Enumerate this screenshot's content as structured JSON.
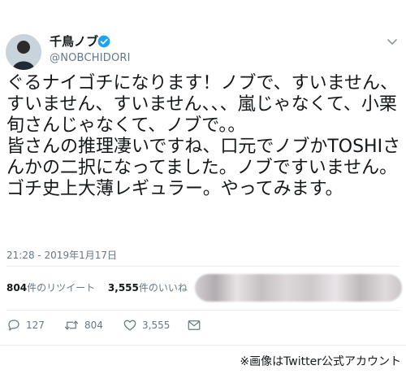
{
  "user": {
    "display_name": "千鳥ノブ",
    "handle": "@NOBCHIDORI",
    "verified": true
  },
  "tweet": {
    "text": "ぐるナイゴチになります！ノブで、すいません、すいません、すいません、、、嵐じゃなくて、小栗旬さんじゃなくて、ノブで。。\n皆さんの推理凄いですね、口元でノブかTOSHIさんかの二択になってました。ノブですいません。\nゴチ史上大薄レギュラー。やってみます。",
    "timestamp": "21:28 - 2019年1月17日"
  },
  "stats": {
    "retweets_count": "804",
    "retweets_label": "件のリツイート",
    "likes_count": "3,555",
    "likes_label": "件のいいね"
  },
  "actions": {
    "reply_count": "127",
    "retweet_count": "804",
    "like_count": "3,555"
  },
  "caption": "※画像はTwitter公式アカウント",
  "colors": {
    "text": "#14171a",
    "muted": "#657786",
    "verified_blue": "#1da1f2",
    "divider": "#e6ecf0"
  },
  "icons": [
    "avatar",
    "verified-badge-icon",
    "chevron-down-icon",
    "reply-icon",
    "retweet-icon",
    "like-icon",
    "message-icon"
  ]
}
